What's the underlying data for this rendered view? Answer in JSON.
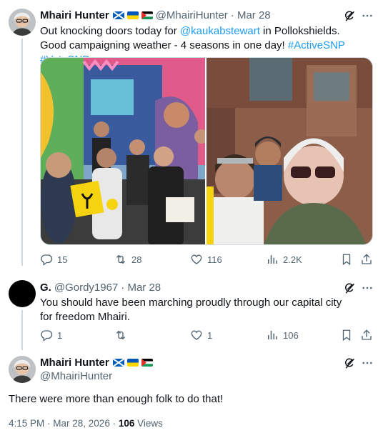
{
  "tweet1": {
    "name": "Mhairi Hunter",
    "handle": "@MhairiHunter",
    "date": "· Mar 28",
    "text_a": "Out knocking doors today for ",
    "mention": "@kaukabstewart",
    "text_b": " in Pollokshields. Good campaigning weather - 4 seasons in one day! ",
    "hashtag1": "#ActiveSNP",
    "hashtag2": "#VoteSNP",
    "replies": "15",
    "reposts": "28",
    "likes": "116",
    "views": "2.2K"
  },
  "tweet2": {
    "name": "G.",
    "handle": "@Gordy1967",
    "date": "· Mar 28",
    "text": "You should have been  marching proudly through our capital city for freedom Mhairi.",
    "replies": "1",
    "reposts": "",
    "likes": "1",
    "views": "106"
  },
  "tweet3": {
    "name": "Mhairi Hunter",
    "handle": "@MhairiHunter",
    "text": "There were more than enough folk to do that!",
    "timestamp": "4:15 PM · Mar 28, 2026 · ",
    "view_count": "106",
    "views_label": " Views"
  },
  "icons": {
    "more": "more-icon",
    "grok": "grok-icon",
    "reply": "reply-icon",
    "repost": "repost-icon",
    "like": "like-icon",
    "views": "views-icon",
    "bookmark": "bookmark-icon",
    "share": "share-icon"
  },
  "colors": {
    "accent": "#1d9bf0",
    "muted": "#536471",
    "text": "#0f1419",
    "border": "#cfd9de"
  }
}
